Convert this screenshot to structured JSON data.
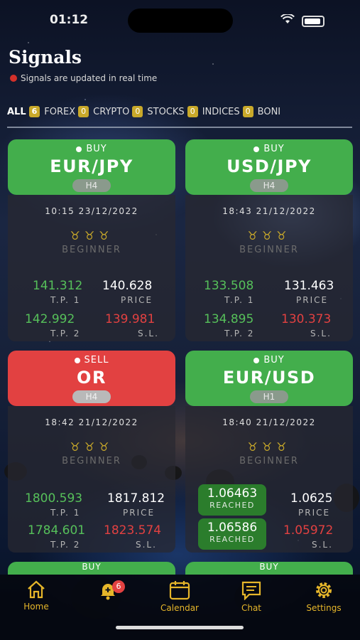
{
  "status_bar": {
    "time": "01:12"
  },
  "header": {
    "title": "Signals",
    "subtitle": "Signals are updated in real time"
  },
  "tabs": [
    {
      "label": "ALL",
      "count": "6",
      "active": true
    },
    {
      "label": "FOREX",
      "count": "0"
    },
    {
      "label": "CRYPTO",
      "count": "0"
    },
    {
      "label": "STOCKS",
      "count": "0"
    },
    {
      "label": "INDICES",
      "count": "0"
    },
    {
      "label": "BONI",
      "count": ""
    }
  ],
  "cards": [
    {
      "side": "BUY",
      "pair": "EUR/JPY",
      "timeframe": "H4",
      "date": "10:15 23/12/2022",
      "level": "BEGINNER",
      "tp1": "141.312",
      "tp1_label": "T.P. 1",
      "price": "140.628",
      "price_label": "PRICE",
      "tp2": "142.992",
      "tp2_label": "T.P. 2",
      "sl": "139.981",
      "sl_label": "S.L."
    },
    {
      "side": "BUY",
      "pair": "USD/JPY",
      "timeframe": "H4",
      "date": "18:43 21/12/2022",
      "level": "BEGINNER",
      "tp1": "133.508",
      "tp1_label": "T.P. 1",
      "price": "131.463",
      "price_label": "PRICE",
      "tp2": "134.895",
      "tp2_label": "T.P. 2",
      "sl": "130.373",
      "sl_label": "S.L."
    },
    {
      "side": "SELL",
      "pair": "OR",
      "timeframe": "H4",
      "date": "18:42 21/12/2022",
      "level": "BEGINNER",
      "tp1": "1800.593",
      "tp1_label": "T.P. 1",
      "price": "1817.812",
      "price_label": "PRICE",
      "tp2": "1784.601",
      "tp2_label": "T.P. 2",
      "sl": "1823.574",
      "sl_label": "S.L."
    },
    {
      "side": "BUY",
      "pair": "EUR/USD",
      "timeframe": "H1",
      "date": "18:40 21/12/2022",
      "level": "BEGINNER",
      "tp1": "1.06463",
      "tp1_label": "REACHED",
      "price": "1.0625",
      "price_label": "PRICE",
      "tp2": "1.06586",
      "tp2_label": "REACHED",
      "sl": "1.05972",
      "sl_label": "S.L."
    }
  ],
  "peek_cards": [
    {
      "side": "BUY"
    },
    {
      "side": "BUY"
    }
  ],
  "nav": {
    "home": "Home",
    "alerts_badge": "6",
    "calendar": "Calendar",
    "chat": "Chat",
    "settings": "Settings"
  },
  "colors": {
    "buy": "#43ae4c",
    "sell": "#e24141",
    "accent": "#e6b62a",
    "badge": "#c9a92a"
  }
}
